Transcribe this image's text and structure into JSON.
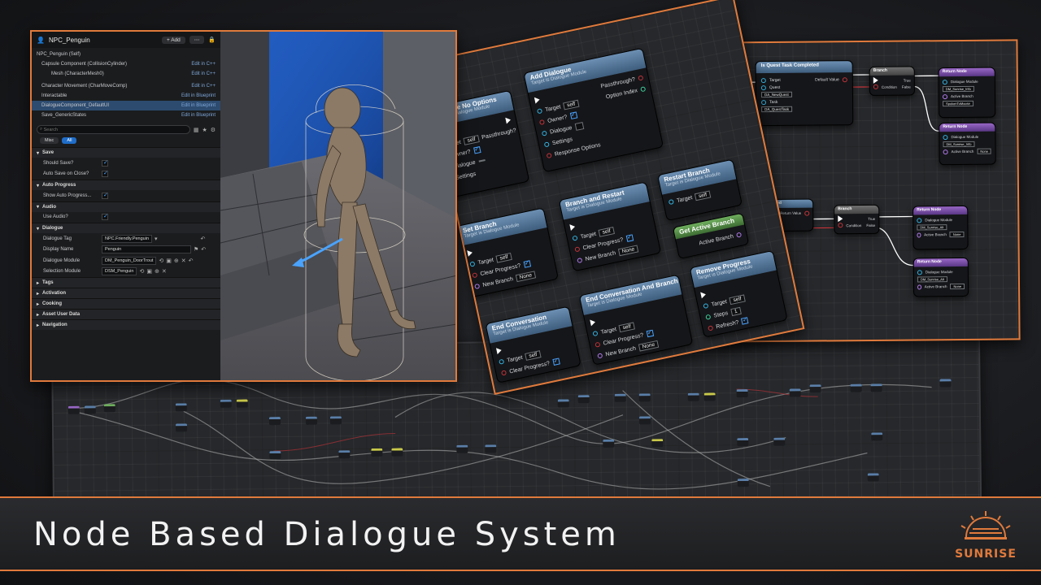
{
  "banner": {
    "title": "Node Based Dialogue System",
    "logo_text": "SUNRISE"
  },
  "details": {
    "actor_name": "NPC_Penguin",
    "add_label": "+ Add",
    "tree": [
      {
        "label": "NPC_Penguin (Self)",
        "edit": ""
      },
      {
        "label": "Capsule Component (CollisionCylinder)",
        "edit": "Edit in C++"
      },
      {
        "label": "Mesh (CharacterMesh0)",
        "edit": "Edit in C++"
      },
      {
        "label": "Character Movement (CharMoveComp)",
        "edit": "Edit in C++"
      },
      {
        "label": "Interactable",
        "edit": "Edit in Blueprint"
      },
      {
        "label": "DialogueComponent_DefaultUI",
        "edit": "Edit in Blueprint"
      },
      {
        "label": "Save_GenericStates",
        "edit": "Edit in Blueprint"
      }
    ],
    "search_placeholder": "Search",
    "filter_misc": "Misc",
    "filter_all": "All",
    "sections": {
      "save": "Save",
      "should_save": "Should Save?",
      "auto_save": "Auto Save on Close?",
      "auto_progress": "Auto Progress",
      "show_auto_progress": "Show Auto Progress...",
      "audio": "Audio",
      "use_audio": "Use Audio?",
      "dialogue": "Dialogue",
      "dialogue_tag": "Dialogue Tag",
      "dialogue_tag_val": "NPC.Friendly.Penguin",
      "display_name": "Display Name",
      "display_name_val": "Penguin",
      "dialogue_module": "Dialogue Module",
      "dialogue_module_val": "DM_Penguin_DoorTrout",
      "selection_module": "Selection Module",
      "selection_module_val": "DSM_Penguin",
      "tags": "Tags",
      "activation": "Activation",
      "cooking": "Cooking",
      "asset_user_data": "Asset User Data",
      "navigation": "Navigation"
    }
  },
  "mid_nodes": {
    "no_options": {
      "title": "Dialogue No Options",
      "sub": "Target is Dialogue Module",
      "target": "Target",
      "self": "self",
      "passthrough": "Passthrough?",
      "owner": "Owner?",
      "dialogue": "Dialogue",
      "settings": "Settings"
    },
    "add_dialogue": {
      "title": "Add Dialogue",
      "sub": "Target is Dialogue Module",
      "target": "Target",
      "self": "self",
      "passthrough": "Passthrough?",
      "option_index": "Option Index",
      "owner": "Owner?",
      "dialogue": "Dialogue",
      "settings": "Settings",
      "response_options": "Response Options"
    },
    "set_branch": {
      "title": "Set Branch",
      "sub": "Target is Dialogue Module",
      "target": "Target",
      "self": "self",
      "clear": "Clear Progress?",
      "new_branch": "New Branch",
      "none": "None"
    },
    "branch_restart": {
      "title": "Branch and Restart",
      "sub": "Target is Dialogue Module",
      "target": "Target",
      "self": "self",
      "clear": "Clear Progress?",
      "new_branch": "New Branch",
      "none": "None"
    },
    "restart_branch": {
      "title": "Restart Branch",
      "sub": "Target is Dialogue Module",
      "target": "Target",
      "self": "self"
    },
    "get_active": {
      "title": "Get Active Branch",
      "active": "Active Branch"
    },
    "end_conversation": {
      "title": "End Conversation",
      "sub": "Target is Dialogue Module",
      "target": "Target",
      "self": "self",
      "clear": "Clear Progress?"
    },
    "end_conv_branch": {
      "title": "End Conversation And Branch",
      "sub": "Target is Dialogue Module",
      "target": "Target",
      "self": "self",
      "clear": "Clear Progress?",
      "new_branch": "New Branch",
      "none": "None"
    },
    "remove_progress": {
      "title": "Remove Progress",
      "sub": "Target is Dialogue Module",
      "target": "Target",
      "self": "self",
      "steps": "Steps",
      "steps_val": "1",
      "refresh": "Refresh?"
    }
  },
  "right_nodes": {
    "quest": {
      "title": "Is Quest Task Completed",
      "target": "Target",
      "quest": "Quest",
      "task": "Task",
      "default": "Default Value",
      "quest_val": "DA_NewQuest",
      "task_val": "DA_QuestTask"
    },
    "branch": {
      "title": "Branch",
      "condition": "Condition",
      "true": "True",
      "false": "False"
    },
    "return1": {
      "title": "Return Node",
      "module": "Dialogue Module",
      "module_val": "DM_Sunrise_Info",
      "active": "Active Branch",
      "active_val": "SpokenToMoose"
    },
    "return2": {
      "title": "Return Node",
      "module": "Dialogue Module",
      "module_val": "DM_Sunrise_Info",
      "active": "Active Branch",
      "active_val": "None"
    },
    "completed2": {
      "title": "Completed",
      "return": "Return Value"
    },
    "branch2": {
      "title": "Branch",
      "condition": "Condition",
      "true": "True",
      "false": "False"
    },
    "return3": {
      "title": "Return Node",
      "module": "Dialogue Module",
      "module_val": "DM_Sunrise_Alt",
      "active": "Active Branch",
      "active_val": "None"
    },
    "return4": {
      "title": "Return Node",
      "module": "Dialogue Module",
      "module_val": "DM_Sunrise_Alt",
      "active": "Active Branch",
      "active_val": "None"
    }
  },
  "colors": {
    "accent": "#e07a3c",
    "node_header": "#5b7ea3",
    "bool_pin": "#c6343a",
    "object_pin": "#35b6e6"
  },
  "icons": [
    "plus-icon",
    "search-icon",
    "star-icon",
    "gear-icon",
    "checkbox-icon",
    "reset-arrow-icon",
    "sun-logo-icon"
  ]
}
